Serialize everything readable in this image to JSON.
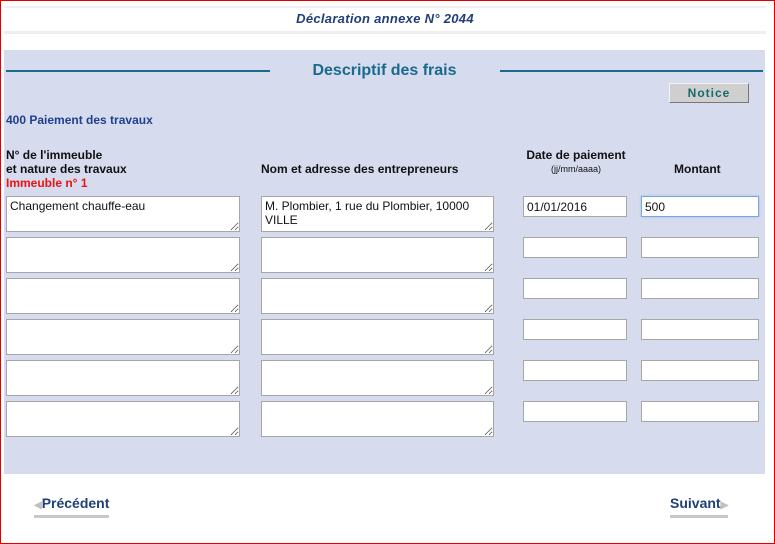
{
  "header": {
    "title": "Déclaration annexe N° 2044"
  },
  "section": {
    "title": "Descriptif des frais",
    "notice_label": "Notice",
    "subsection_title": "400 Paiement des travaux"
  },
  "columns": {
    "col1_line1": "N° de l'immeuble",
    "col1_line2": "et nature des travaux",
    "immeuble_label": "Immeuble n° 1",
    "col2": "Nom et adresse des entrepreneurs",
    "col3": "Date de paiement",
    "col3_hint": "(jj/mm/aaaa)",
    "col4": "Montant"
  },
  "rows": [
    {
      "nature": "Changement chauffe-eau",
      "entrepreneur": "M. Plombier, 1 rue du Plombier, 10000 VILLE",
      "date": "01/01/2016",
      "montant": "500"
    },
    {
      "nature": "",
      "entrepreneur": "",
      "date": "",
      "montant": ""
    },
    {
      "nature": "",
      "entrepreneur": "",
      "date": "",
      "montant": ""
    },
    {
      "nature": "",
      "entrepreneur": "",
      "date": "",
      "montant": ""
    },
    {
      "nature": "",
      "entrepreneur": "",
      "date": "",
      "montant": ""
    },
    {
      "nature": "",
      "entrepreneur": "",
      "date": "",
      "montant": ""
    }
  ],
  "nav": {
    "previous_label": "Précédent",
    "next_label": "Suivant",
    "previous_icon": "triangle-left-icon",
    "next_icon": "triangle-right-icon"
  }
}
